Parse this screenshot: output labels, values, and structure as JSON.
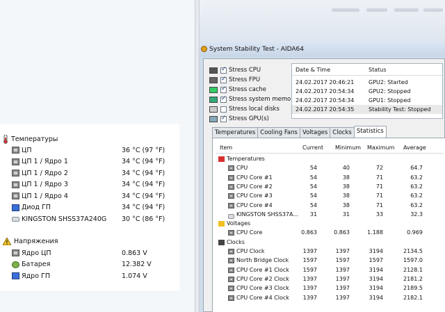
{
  "sensors": {
    "temperatures": {
      "title": "Температуры",
      "rows": [
        {
          "name": "ЦП",
          "value": "36 °C  (97 °F)",
          "icon": "chip-icon"
        },
        {
          "name": "ЦП 1 / Ядро 1",
          "value": "34 °C  (94 °F)",
          "icon": "chip-icon"
        },
        {
          "name": "ЦП 1 / Ядро 2",
          "value": "34 °C  (94 °F)",
          "icon": "chip-icon"
        },
        {
          "name": "ЦП 1 / Ядро 3",
          "value": "34 °C  (94 °F)",
          "icon": "chip-icon"
        },
        {
          "name": "ЦП 1 / Ядро 4",
          "value": "34 °C  (94 °F)",
          "icon": "chip-icon"
        },
        {
          "name": "Диод ГП",
          "value": "34 °C  (94 °F)",
          "icon": "monitor-icon"
        },
        {
          "name": "KINGSTON SHSS37A240G",
          "value": "30 °C  (86 °F)",
          "icon": "drive-icon"
        }
      ]
    },
    "voltages": {
      "title": "Напряжения",
      "rows": [
        {
          "name": "Ядро ЦП",
          "value": "0.863 V",
          "icon": "chip-icon"
        },
        {
          "name": "Батарея",
          "value": "12.382 V",
          "icon": "battery-icon"
        },
        {
          "name": "Ядро ГП",
          "value": "1.074 V",
          "icon": "monitor-icon"
        }
      ]
    }
  },
  "window": {
    "title": "System Stability Test - AIDA64",
    "stress_options": [
      {
        "label": "Stress CPU",
        "checked": true
      },
      {
        "label": "Stress FPU",
        "checked": true
      },
      {
        "label": "Stress cache",
        "checked": true
      },
      {
        "label": "Stress system memory",
        "checked": true
      },
      {
        "label": "Stress local disks",
        "checked": false
      },
      {
        "label": "Stress GPU(s)",
        "checked": true
      }
    ],
    "log": {
      "col_datetime": "Date & Time",
      "col_status": "Status",
      "rows": [
        {
          "datetime": "24.02.2017 20:46:21",
          "status": "GPU2: Started"
        },
        {
          "datetime": "24.02.2017 20:54:34",
          "status": "GPU2: Stopped"
        },
        {
          "datetime": "24.02.2017 20:54:34",
          "status": "GPU1: Stopped"
        },
        {
          "datetime": "24.02.2017 20:54:35",
          "status": "Stability Test: Stopped"
        }
      ]
    },
    "tabs": [
      "Temperatures",
      "Cooling Fans",
      "Voltages",
      "Clocks",
      "Statistics"
    ],
    "active_tab": "Statistics",
    "stats": {
      "columns": {
        "item": "Item",
        "current": "Current",
        "minimum": "Minimum",
        "maximum": "Maximum",
        "average": "Average"
      },
      "groups": [
        {
          "name": "Temperatures",
          "rows": [
            {
              "item": "CPU",
              "current": "54",
              "minimum": "40",
              "maximum": "72",
              "average": "64.7"
            },
            {
              "item": "CPU Core #1",
              "current": "54",
              "minimum": "38",
              "maximum": "71",
              "average": "63.2"
            },
            {
              "item": "CPU Core #2",
              "current": "54",
              "minimum": "38",
              "maximum": "71",
              "average": "63.2"
            },
            {
              "item": "CPU Core #3",
              "current": "54",
              "minimum": "38",
              "maximum": "71",
              "average": "63.2"
            },
            {
              "item": "CPU Core #4",
              "current": "54",
              "minimum": "38",
              "maximum": "71",
              "average": "63.2"
            },
            {
              "item": "KINGSTON SHSS37A...",
              "current": "31",
              "minimum": "31",
              "maximum": "33",
              "average": "32.3"
            }
          ]
        },
        {
          "name": "Voltages",
          "rows": [
            {
              "item": "CPU Core",
              "current": "0.863",
              "minimum": "0.863",
              "maximum": "1.188",
              "average": "0.969"
            }
          ]
        },
        {
          "name": "Clocks",
          "rows": [
            {
              "item": "CPU Clock",
              "current": "1397",
              "minimum": "1397",
              "maximum": "3194",
              "average": "2134.5"
            },
            {
              "item": "North Bridge Clock",
              "current": "1597",
              "minimum": "1597",
              "maximum": "1597",
              "average": "1597.0"
            },
            {
              "item": "CPU Core #1 Clock",
              "current": "1597",
              "minimum": "1397",
              "maximum": "3194",
              "average": "2128.1"
            },
            {
              "item": "CPU Core #2 Clock",
              "current": "1397",
              "minimum": "1397",
              "maximum": "3194",
              "average": "2181.2"
            },
            {
              "item": "CPU Core #3 Clock",
              "current": "1397",
              "minimum": "1397",
              "maximum": "3194",
              "average": "2189.5"
            },
            {
              "item": "CPU Core #4 Clock",
              "current": "1397",
              "minimum": "1397",
              "maximum": "3194",
              "average": "2182.1"
            }
          ]
        }
      ]
    }
  }
}
